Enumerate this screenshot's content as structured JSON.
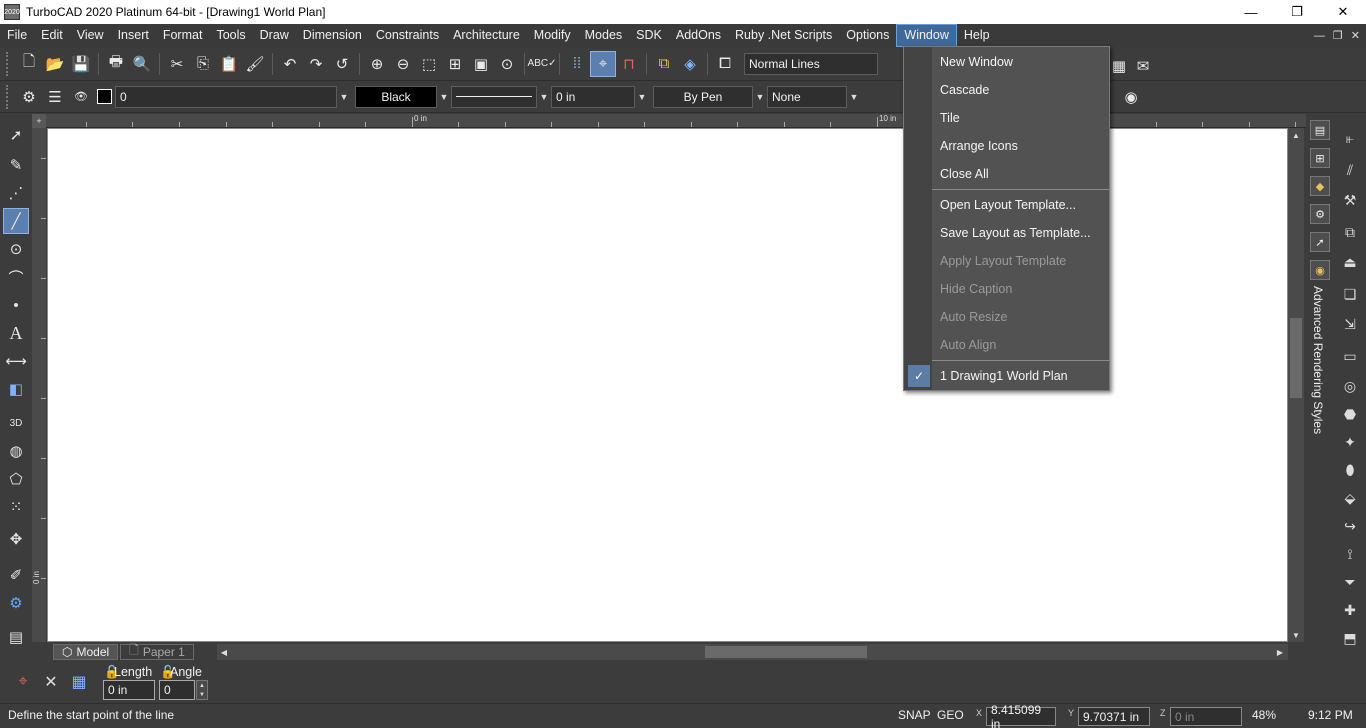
{
  "title_bar": {
    "title": "TurboCAD 2020 Platinum 64-bit - [Drawing1 World Plan]",
    "app_icon_text": "2020",
    "minimize": "—",
    "maximize": "❐",
    "close": "✕"
  },
  "menubar": {
    "items": [
      "File",
      "Edit",
      "View",
      "Insert",
      "Format",
      "Tools",
      "Draw",
      "Dimension",
      "Constraints",
      "Architecture",
      "Modify",
      "Modes",
      "SDK",
      "AddOns",
      "Ruby .Net Scripts",
      "Options",
      "Window",
      "Help"
    ],
    "active": "Window",
    "mdi_minimize": "—",
    "mdi_restore": "❐",
    "mdi_close": "✕"
  },
  "toolbar1": {
    "line_style": "Normal Lines"
  },
  "toolbar2": {
    "layer": "0",
    "color": "Black",
    "thickness": "0 in",
    "pen": "By Pen",
    "fill": "None"
  },
  "ruler": {
    "h_label_0": "0 in",
    "h_label_10": "10 in",
    "v_label_0": "0 in"
  },
  "tabs": {
    "model": "Model",
    "paper": "Paper 1"
  },
  "right_panel": {
    "label": "Advanced Rendering Styles"
  },
  "window_menu": {
    "items": [
      {
        "label": "New Window",
        "enabled": true
      },
      {
        "label": "Cascade",
        "enabled": true
      },
      {
        "label": "Tile",
        "enabled": true
      },
      {
        "label": "Arrange Icons",
        "enabled": true
      },
      {
        "label": "Close All",
        "enabled": true
      },
      {
        "label": "Open Layout Template...",
        "enabled": true
      },
      {
        "label": "Save Layout as Template...",
        "enabled": true
      },
      {
        "label": "Apply Layout Template",
        "enabled": false
      },
      {
        "label": "Hide Caption",
        "enabled": false
      },
      {
        "label": "Auto Resize",
        "enabled": false
      },
      {
        "label": "Auto Align",
        "enabled": false
      },
      {
        "label": "1 Drawing1 World Plan",
        "enabled": true,
        "checked": true
      }
    ]
  },
  "inputbar": {
    "length_label": "Length",
    "angle_label": "Angle",
    "length_value": "0 in",
    "angle_value": "0"
  },
  "statusbar": {
    "prompt": "Define the start point of the line",
    "snap": "SNAP",
    "geo": "GEO",
    "x_axis": "X",
    "y_axis": "Y",
    "z_axis": "Z",
    "x": "8.415099 in",
    "y": "9.70371 in",
    "z": "0 in",
    "zoom": "48%",
    "time": "9:12 PM"
  },
  "icons": {
    "toolbar1": [
      "new-file-icon",
      "open-folder-icon",
      "save-icon",
      "print-icon",
      "print-preview-icon",
      "cut-icon",
      "copy-icon",
      "paste-icon",
      "format-painter-icon",
      "undo-icon",
      "redo-icon",
      "lasso-icon",
      "zoom-in-icon",
      "zoom-out-icon",
      "zoom-window-icon",
      "zoom-extents-icon",
      "zoom-page-icon",
      "zoom-all-icon",
      "spell-check-icon",
      "grid-icon",
      "snap-icon",
      "magnet-icon",
      "layers-icon",
      "views-icon",
      "explorer-icon"
    ],
    "left": [
      "select-icon",
      "edit-tool-icon",
      "point-icon",
      "line-icon",
      "circle-icon",
      "arc-icon",
      "dot-icon",
      "text-icon",
      "dimension-icon",
      "shape-icon",
      "3d-icon",
      "solid-icon",
      "eraser-icon",
      "array-icon",
      "move-icon",
      "pencil-icon",
      "gear-icon",
      "window-icon"
    ]
  }
}
